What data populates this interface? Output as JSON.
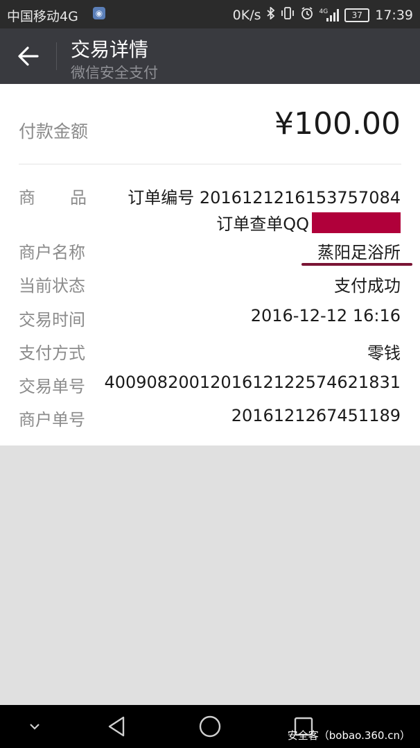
{
  "status_bar": {
    "carrier": "中国移动4G",
    "speed": "0K/s",
    "network": "4G",
    "battery": "37",
    "time": "17:39",
    "icons": [
      "app-notification-icon",
      "bluetooth-icon",
      "vibrate-icon",
      "alarm-icon",
      "signal-icon",
      "battery-icon"
    ]
  },
  "header": {
    "title": "交易详情",
    "subtitle": "微信安全支付"
  },
  "payment": {
    "amount_label": "付款金额",
    "amount_value": "¥100.00",
    "rows": [
      {
        "key": "商品",
        "value_line1": "订单编号 2016121216153757084",
        "value_line2": "订单查单QQ"
      },
      {
        "key": "商户名称",
        "value": "蒸阳足浴所"
      },
      {
        "key": "当前状态",
        "value": "支付成功"
      },
      {
        "key": "交易时间",
        "value": "2016-12-12 16:16"
      },
      {
        "key": "支付方式",
        "value": "零钱"
      },
      {
        "key": "交易单号",
        "value": "4009082001201612122574621831"
      },
      {
        "key": "商户单号",
        "value": "2016121267451189"
      }
    ]
  },
  "colors": {
    "header_bg": "#393a3f",
    "status_bar_bg": "#2b2b2b",
    "redaction": "#b0003a",
    "annotation_underline": "#7a1535"
  },
  "navbar": {
    "icons": [
      "chevron-down-icon",
      "back-triangle-icon",
      "home-circle-icon",
      "recents-square-icon"
    ]
  },
  "watermark": "安全客（bobao.360.cn）"
}
